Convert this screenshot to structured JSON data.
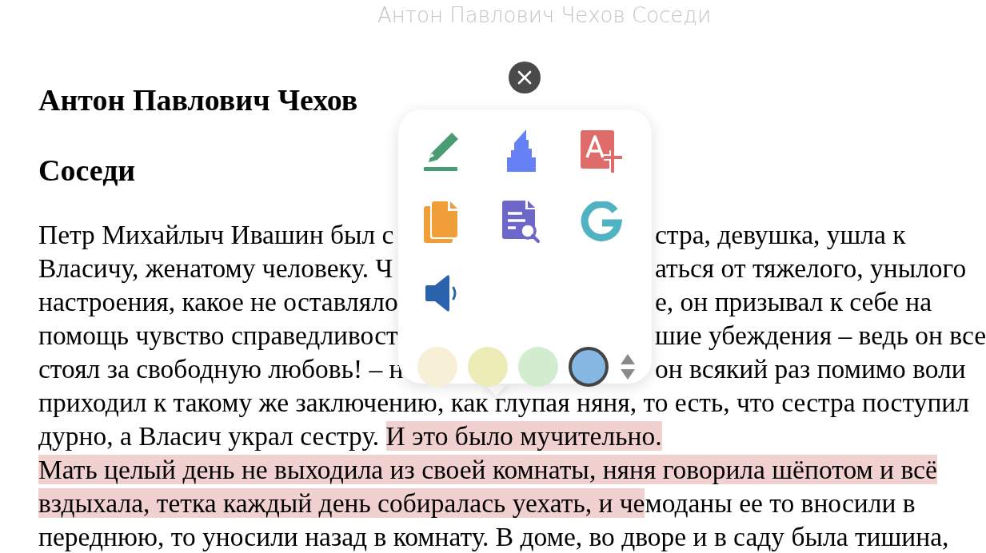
{
  "page_title": "Антон Павлович Чехов Соседи",
  "author_heading": "Антон Павлович Чехов",
  "story_heading": "Соседи",
  "lines": [
    {
      "left": [
        {
          "text": "Петр Михайлыч Ивашин был с",
          "highlighted": false
        }
      ],
      "right": [
        {
          "text": "стра, девушка, ушла к",
          "highlighted": false
        }
      ]
    },
    {
      "left": [
        {
          "text": "Власичу, женатому человеку. Ч",
          "highlighted": false
        }
      ],
      "right": [
        {
          "text": "аться от тяжелого, унылого",
          "highlighted": false
        }
      ]
    },
    {
      "left": [
        {
          "text": "настроения, какое не оставляло",
          "highlighted": false
        }
      ],
      "right": [
        {
          "text": "е, он призывал к себе на",
          "highlighted": false
        }
      ]
    },
    {
      "left": [
        {
          "text": "помощь чувство справедливост",
          "highlighted": false
        }
      ],
      "right": [
        {
          "text": "шие убеждения – ведь он все",
          "highlighted": false
        }
      ]
    },
    {
      "left": [
        {
          "text": "стоял за свободную любовь! – н",
          "highlighted": false
        }
      ],
      "right": [
        {
          "text": "он всякий раз помимо воли",
          "highlighted": false
        }
      ]
    },
    {
      "left": [
        {
          "text": "приходил к такому же заключению, как глупая няня, то есть, что сестра поступил",
          "highlighted": false
        }
      ]
    },
    {
      "left": [
        {
          "text": "дурно, а Власич украл сестру. ",
          "highlighted": false
        },
        {
          "text": "И это было мучительно. ",
          "highlighted": true
        }
      ]
    },
    {
      "left": [
        {
          "text": "Мать целый день не выходила из своей комнаты, няня говорила шёпотом и всё",
          "highlighted": true
        }
      ]
    },
    {
      "left": [
        {
          "text": "вздыхала, тетка каждый день собиралась уехать, и че",
          "highlighted": true
        },
        {
          "text": "моданы ее то вносили в",
          "highlighted": false
        }
      ]
    },
    {
      "left": [
        {
          "text": "переднюю, то уносили назад в комнату. В доме, во дворе и в саду была тишина,",
          "highlighted": false
        }
      ]
    }
  ],
  "popup": {
    "tools": [
      {
        "kind": "pencil"
      },
      {
        "kind": "highlighter"
      },
      {
        "kind": "font-add"
      },
      {
        "kind": "copy"
      },
      {
        "kind": "doc-search"
      },
      {
        "kind": "google"
      },
      {
        "kind": "speaker"
      }
    ],
    "swatches": [
      {
        "color": "#f7efd6",
        "selected": false
      },
      {
        "color": "#eeecb6",
        "selected": false
      },
      {
        "color": "#d2ecd0",
        "selected": false
      },
      {
        "color": "#85b9e3",
        "selected": true
      }
    ]
  }
}
